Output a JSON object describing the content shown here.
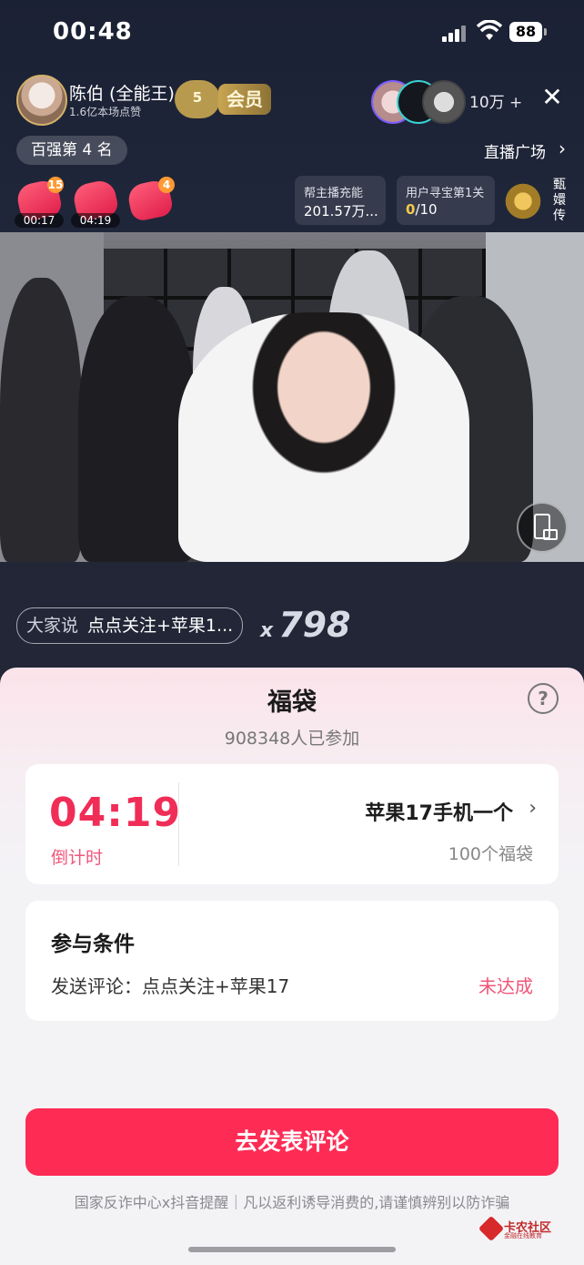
{
  "status_bar": {
    "time": "00:48",
    "battery": "88"
  },
  "host": {
    "name": "陈伯 (全能王)",
    "likes": "1.6亿本场点赞",
    "fan_level": "5",
    "vip_label": "会员"
  },
  "viewers": {
    "count": "10万 +"
  },
  "rank": "百强第 4 名",
  "live_plaza": "直播广场",
  "lucky_bags": [
    {
      "count": "15",
      "timer": "00:17"
    },
    {
      "count": "",
      "timer": "04:19"
    },
    {
      "count": "4",
      "timer": ""
    }
  ],
  "charge_card": {
    "label": "帮主播充能",
    "value": "201.57万..."
  },
  "treasure_card": {
    "label": "用户寻宝第1关",
    "progress": "0",
    "total": "/10"
  },
  "zhen_huan": "甄嬛传",
  "chat": {
    "prefix": "大家说",
    "text": "点点关注+苹果1...",
    "times_symbol": "x",
    "times": "798"
  },
  "sheet": {
    "title": "福袋",
    "participants": "908348人已参加",
    "countdown": "04:19",
    "countdown_label": "倒计时",
    "prize_name": "苹果17手机一个",
    "prize_qty": "100个福袋",
    "condition_title": "参与条件",
    "condition_text": "发送评论：点点关注+苹果17",
    "condition_status": "未达成",
    "cta": "去发表评论",
    "notice": "国家反诈中心x抖音提醒｜凡以返利诱导消费的,请谨慎辨别以防诈骗",
    "watermark_title": "卡农社区",
    "watermark_sub": "金融在线教育"
  },
  "colors": {
    "accent": "#fe2c55",
    "countdown": "#f02d57",
    "status_warn": "#f0557a"
  }
}
